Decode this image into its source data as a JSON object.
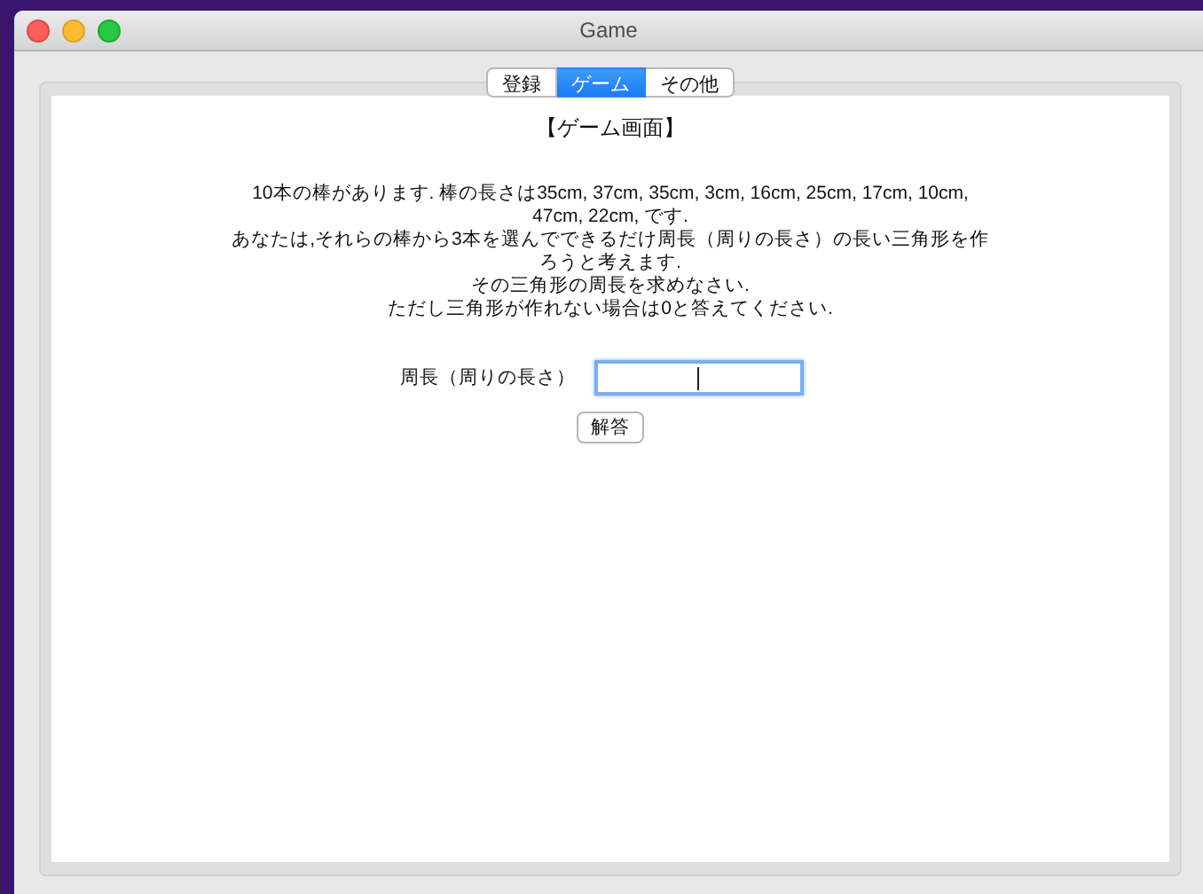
{
  "window": {
    "title": "Game"
  },
  "tabs": [
    {
      "label": "登録",
      "selected": false
    },
    {
      "label": "ゲーム",
      "selected": true
    },
    {
      "label": "その他",
      "selected": false
    }
  ],
  "heading": "【ゲーム画面】",
  "paragraphs": [
    "10本の棒があります. 棒の長さは35cm, 37cm, 35cm, 3cm, 16cm, 25cm, 17cm, 10cm, 47cm, 22cm, です.",
    "あなたは,それらの棒から3本を選んでできるだけ周長（周りの長さ）の長い三角形を作ろうと考えます.",
    "その三角形の周長を求めなさい.",
    "ただし三角形が作れない場合は0と答えてください."
  ],
  "answer_field": {
    "label": "周長（周りの長さ）",
    "focused": true
  },
  "submit_button": "解答"
}
